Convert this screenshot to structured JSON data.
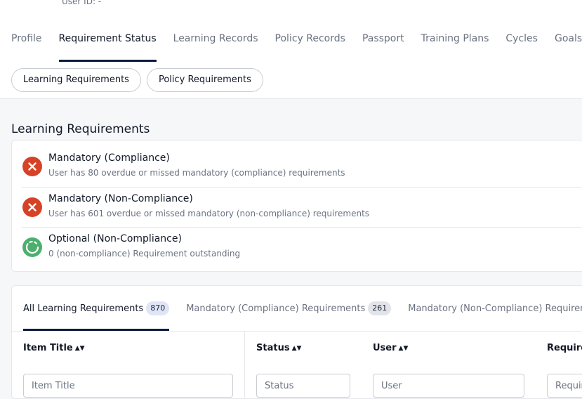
{
  "header": {
    "user_id": "User ID: -"
  },
  "tabs": [
    {
      "label": "Profile",
      "active": false
    },
    {
      "label": "Requirement Status",
      "active": true
    },
    {
      "label": "Learning Records",
      "active": false
    },
    {
      "label": "Policy Records",
      "active": false
    },
    {
      "label": "Passport",
      "active": false
    },
    {
      "label": "Training Plans",
      "active": false
    },
    {
      "label": "Cycles",
      "active": false
    },
    {
      "label": "Goals",
      "active": false
    }
  ],
  "pills": [
    {
      "label": "Learning Requirements"
    },
    {
      "label": "Policy Requirements"
    }
  ],
  "section": {
    "title": "Learning Requirements"
  },
  "requirements": [
    {
      "title": "Mandatory (Compliance)",
      "description": "User has 80 overdue or missed mandatory (compliance) requirements",
      "status": "error",
      "icon": "x-circle-icon"
    },
    {
      "title": "Mandatory (Non-Compliance)",
      "description": "User has 601 overdue or missed mandatory (non-compliance) requirements",
      "status": "error",
      "icon": "x-circle-icon"
    },
    {
      "title": "Optional (Non-Compliance)",
      "description": "0 (non-compliance) Requirement outstanding",
      "status": "ok",
      "icon": "dashed-circle-icon"
    }
  ],
  "sub_tabs": [
    {
      "label": "All Learning Requirements",
      "count": "870",
      "active": true
    },
    {
      "label": "Mandatory (Compliance) Requirements",
      "count": "261",
      "active": false
    },
    {
      "label": "Mandatory (Non-Compliance) Requirements",
      "count": "",
      "active": false
    }
  ],
  "table": {
    "columns": [
      {
        "label": "Item Title",
        "filter_placeholder": "Item Title"
      },
      {
        "label": "Status",
        "filter_placeholder": "Status"
      },
      {
        "label": "User",
        "filter_placeholder": "User"
      },
      {
        "label": "Requirement",
        "filter_placeholder": "Requirement"
      }
    ]
  },
  "colors": {
    "accent": "#0b1a3d",
    "error": "#d64226",
    "success": "#4caf6e"
  }
}
